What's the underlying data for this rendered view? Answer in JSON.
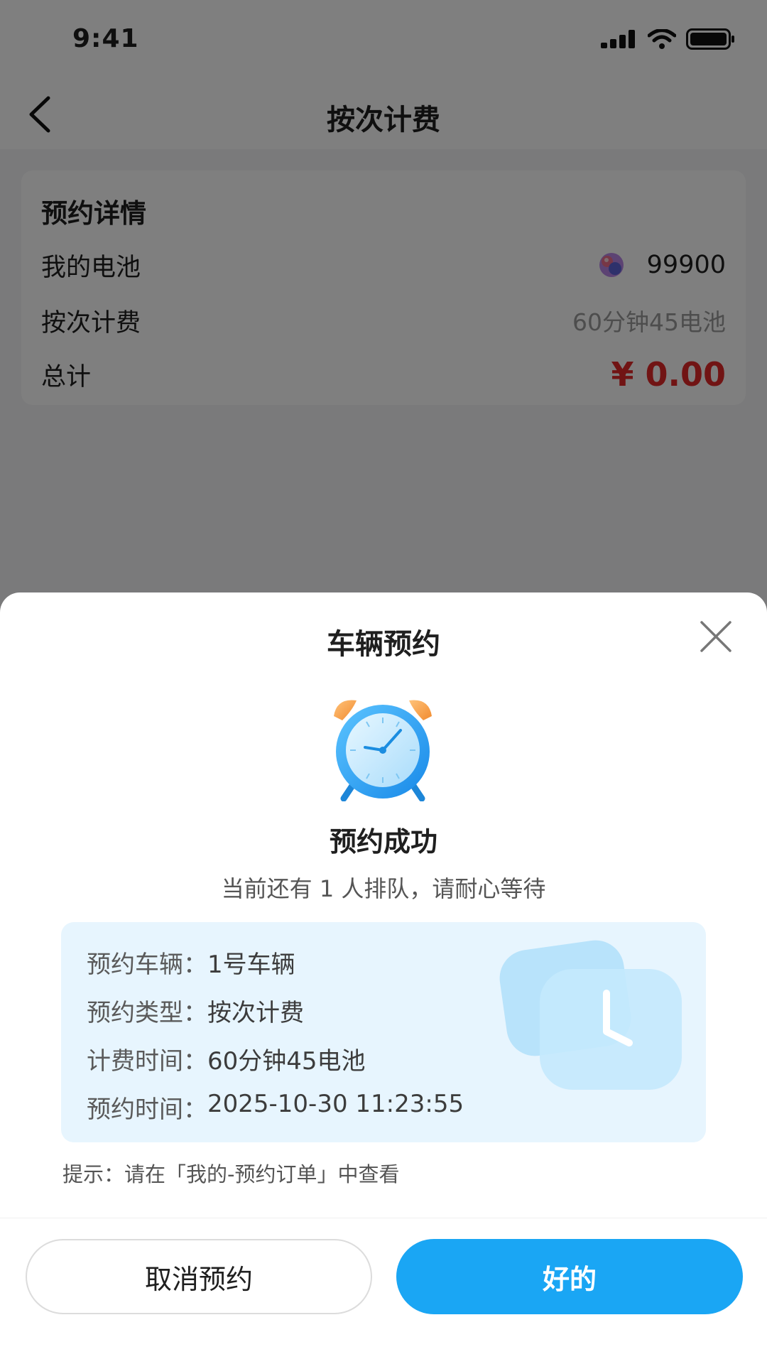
{
  "status_bar": {
    "time": "9:41"
  },
  "nav": {
    "title": "按次计费"
  },
  "details": {
    "heading": "预约详情",
    "battery_label": "我的电池",
    "battery_value": "99900",
    "billing_label": "按次计费",
    "billing_value": "60分钟45电池",
    "total_label": "总计",
    "total_value": "¥ 0.00",
    "total_color": "#e22828"
  },
  "sheet": {
    "title": "车辆预约",
    "success_title": "预约成功",
    "queue_text": "当前还有 1 人排队，请耐心等待",
    "info": [
      {
        "label": "预约车辆：",
        "value": "1号车辆"
      },
      {
        "label": "预约类型：",
        "value": "按次计费"
      },
      {
        "label": "计费时间：",
        "value": "60分钟45电池"
      },
      {
        "label": "预约时间：",
        "value": "2025-10-30 11:23:55"
      }
    ],
    "hint": "提示：请在「我的-预约订单」中查看",
    "cancel_button": "取消预约",
    "ok_button": "好的",
    "accent_color": "#1aa6f4"
  },
  "icons": [
    "signal-icon",
    "wifi-icon",
    "battery-icon",
    "back-icon",
    "gem-icon",
    "close-icon",
    "alarm-clock-icon"
  ]
}
